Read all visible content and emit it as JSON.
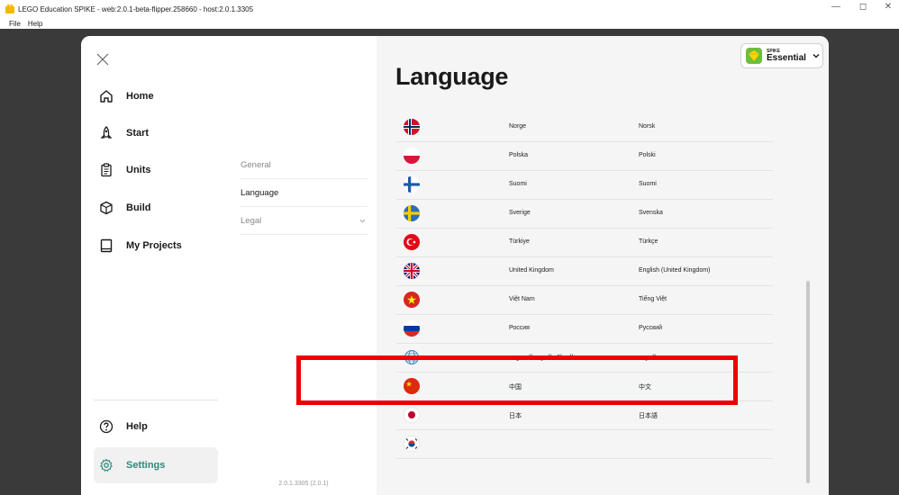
{
  "window": {
    "title": "LEGO Education SPIKE - web:2.0.1-beta-flipper.258660 - host:2.0.1.3305",
    "minimize_glyph": "—",
    "restore_glyph": "◻",
    "close_glyph": "✕"
  },
  "menubar": {
    "file": "File",
    "help": "Help"
  },
  "nav": {
    "items": [
      {
        "label": "Home",
        "icon": "home-icon"
      },
      {
        "label": "Start",
        "icon": "rocket-icon"
      },
      {
        "label": "Units",
        "icon": "clipboard-icon"
      },
      {
        "label": "Build",
        "icon": "cube-icon"
      },
      {
        "label": "My Projects",
        "icon": "book-icon"
      }
    ],
    "help": {
      "label": "Help",
      "icon": "help-icon"
    },
    "settings": {
      "label": "Settings",
      "icon": "gear-icon",
      "active": true
    }
  },
  "settings_menu": {
    "items": [
      "General",
      "Language",
      "Legal"
    ],
    "selected": "Language",
    "version": "2.0.1.3305 (2.0.1)"
  },
  "page": {
    "title": "Language"
  },
  "spike_selector": {
    "brand_small": "SPIKE",
    "product": "Essential",
    "accent": "#6bbf3a"
  },
  "languages": [
    {
      "country": "Norge",
      "language": "Norsk",
      "flag": "norway"
    },
    {
      "country": "Polska",
      "language": "Polski",
      "flag": "poland"
    },
    {
      "country": "Suomi",
      "language": "Suomi",
      "flag": "finland"
    },
    {
      "country": "Sverige",
      "language": "Svenska",
      "flag": "sweden"
    },
    {
      "country": "Türkiye",
      "language": "Türkçe",
      "flag": "turkey"
    },
    {
      "country": "United Kingdom",
      "language": "English (United Kingdom)",
      "flag": "uk"
    },
    {
      "country": "Việt Nam",
      "language": "Tiếng Việt",
      "flag": "vietnam"
    },
    {
      "country": "Россия",
      "language": "Русский",
      "flag": "russia"
    },
    {
      "country": "المملكة العربية السعودية",
      "language": "العربية",
      "flag": "globe"
    },
    {
      "country": "中国",
      "language": "中文",
      "flag": "china"
    },
    {
      "country": "日本",
      "language": "日本語",
      "flag": "japan"
    },
    {
      "country": "",
      "language": "",
      "flag": "korea"
    }
  ],
  "highlight": {
    "target": "日本",
    "color": "#ee0000"
  },
  "colors": {
    "settings_accent": "#2e8a7a",
    "content_bg": "#f5f5f5",
    "backdrop": "#3a3a3a"
  }
}
